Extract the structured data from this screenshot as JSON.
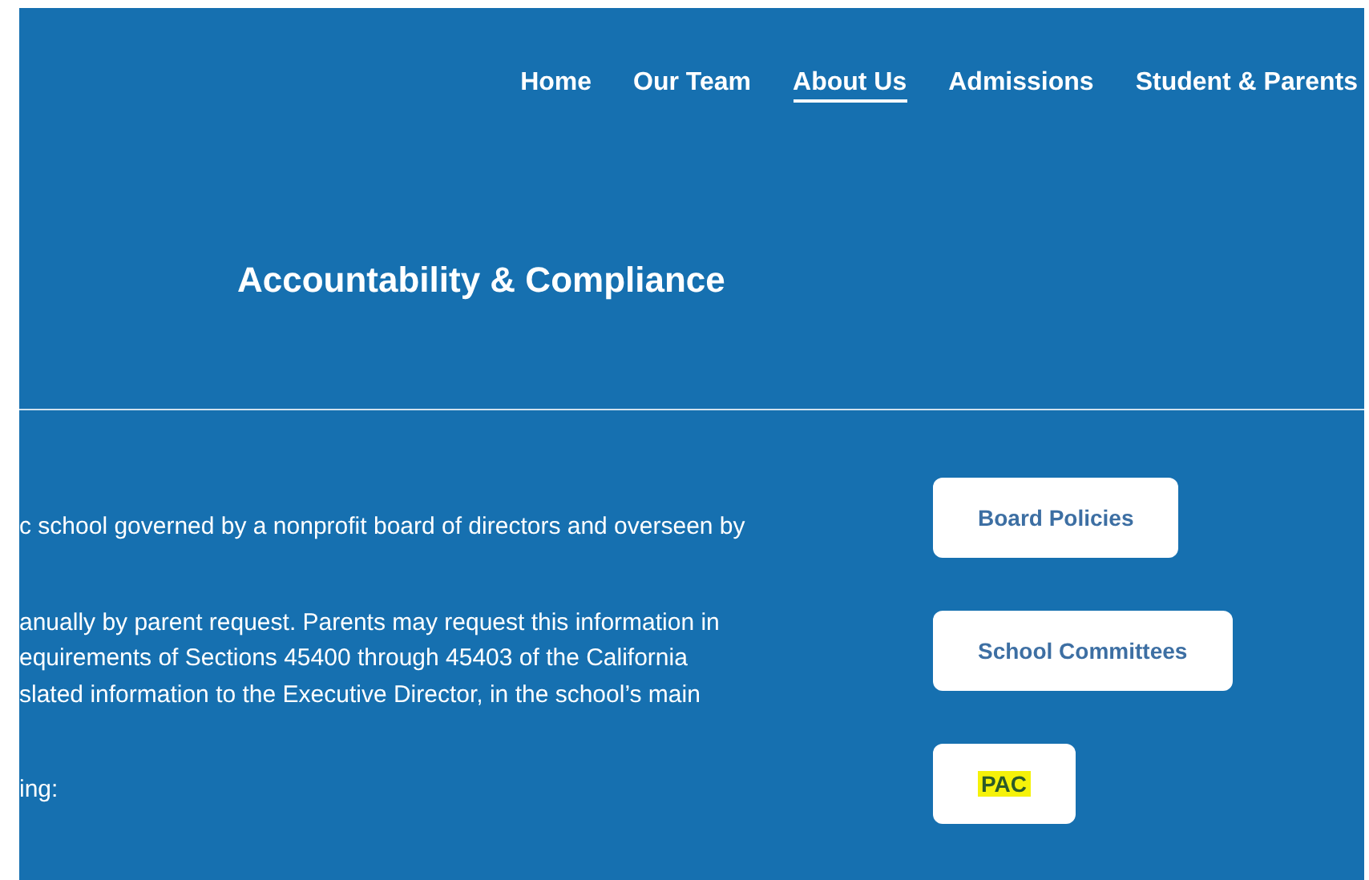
{
  "nav": [
    {
      "label": "Home",
      "selected": false
    },
    {
      "label": "Our Team",
      "selected": false
    },
    {
      "label": "About Us",
      "selected": true
    },
    {
      "label": "Admissions",
      "selected": false
    },
    {
      "label": "Student & Parents",
      "selected": false
    }
  ],
  "title": "Accountability & Compliance",
  "paragraphs": [
    [
      "c school governed by a nonprofit board of directors and overseen by"
    ],
    [
      "anually by parent request. Parents may request this information in",
      "equirements of Sections 45400 through 45403 of the California",
      "slated information to the Executive Director, in the school’s main"
    ],
    [
      "ing:"
    ]
  ],
  "buttons": [
    {
      "label": "Board Policies",
      "highlighted": false
    },
    {
      "label": "School Committees",
      "highlighted": false
    },
    {
      "label": "PAC",
      "highlighted": true
    }
  ]
}
